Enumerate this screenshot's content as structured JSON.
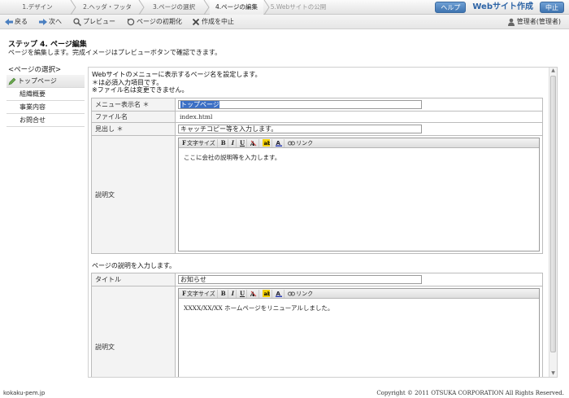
{
  "steps": [
    {
      "label": "1.デザイン",
      "state": "done"
    },
    {
      "label": "2.ヘッダ・フッタ",
      "state": "done"
    },
    {
      "label": "3.ページの選択",
      "state": "done"
    },
    {
      "label": "4.ページの編集",
      "state": "active"
    },
    {
      "label": "5.Webサイトの公開",
      "state": "disabled"
    }
  ],
  "top_buttons": {
    "help": "ヘルプ",
    "app_title": "Webサイト作成",
    "stop": "中止"
  },
  "toolbar": {
    "back": "戻る",
    "next": "次へ",
    "preview": "プレビュー",
    "reset": "ページの初期化",
    "cancel": "作成を中止",
    "user": "管理者(管理者)"
  },
  "step_title": "ステップ 4. ページ編集",
  "step_desc": "ページを編集します。完成イメージはプレビューボタンで確認できます。",
  "sidebar": {
    "heading": "<ページの選択>",
    "items": [
      {
        "label": "トップページ",
        "current": true
      },
      {
        "label": "組織概要"
      },
      {
        "label": "事業内容"
      },
      {
        "label": "お問合せ"
      }
    ]
  },
  "intro": {
    "line1": "Webサイトのメニューに表示するページ名を設定します。",
    "line2": "＊は必須入力項目です。",
    "line3": "※ファイル名は変更できません。"
  },
  "form1": {
    "menu_label": "メニュー表示名 ＊",
    "menu_value": "トップページ",
    "file_label": "ファイル名",
    "file_value": "index.html",
    "heading_label": "見出し ＊",
    "heading_value": "キャッチコピー等を入力します。",
    "desc_label": "説明文",
    "desc_body": "ここに会社の説明等を入力します。"
  },
  "editor_toolbar": {
    "font_size": "文字サイズ",
    "bold": "B",
    "italic": "I",
    "underline": "U",
    "link": "リンク"
  },
  "section2_intro": "ページの説明を入力します。",
  "form2": {
    "title_label": "タイトル",
    "title_value": "お知らせ",
    "desc_label": "説明文",
    "desc_body": "XXXX/XX/XX ホームページをリニューアルしました。"
  },
  "footer": {
    "left": "kokaku-pem.jp",
    "right": "Copyright © 2011 OTSUKA CORPORATION All Rights Reserved."
  },
  "colors": {
    "accent": "#3f74b0",
    "selection": "#3b6fc5"
  }
}
